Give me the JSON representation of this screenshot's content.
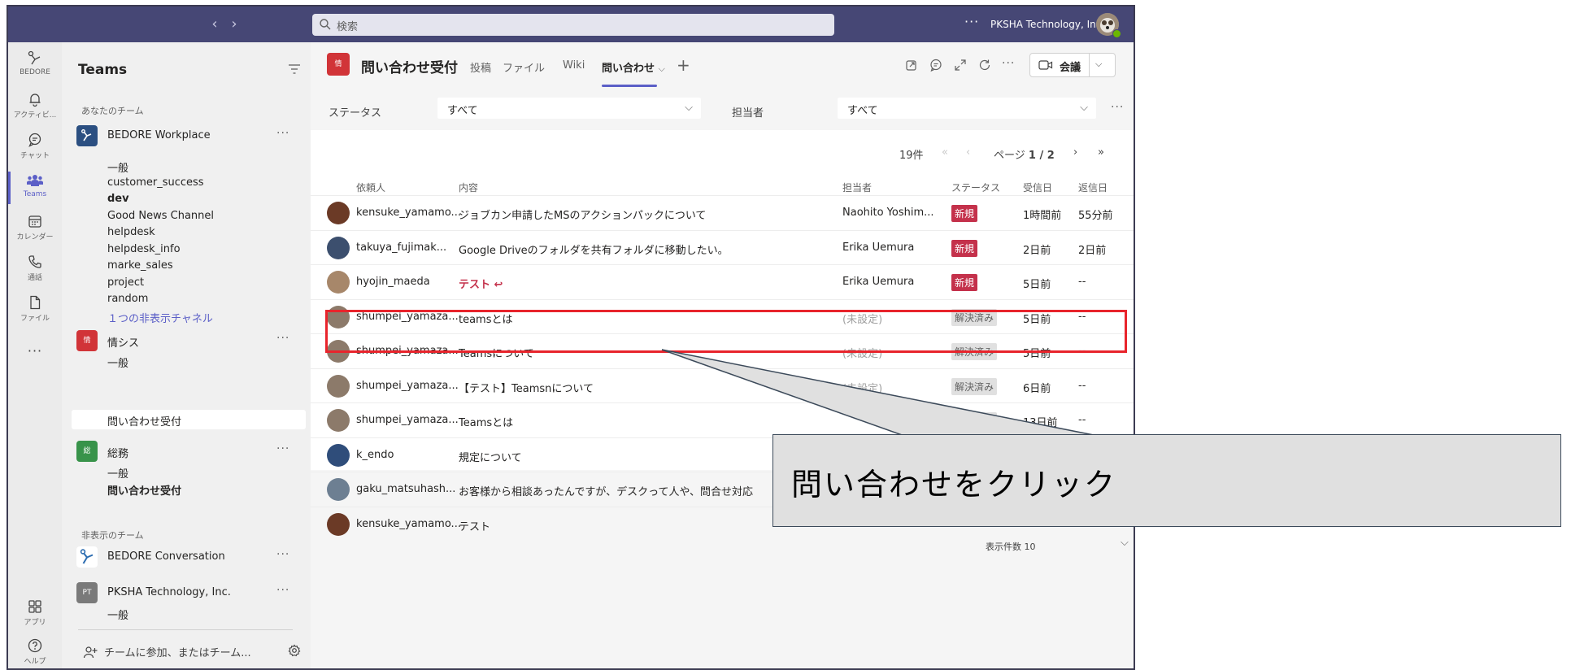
{
  "titlebar": {
    "search_placeholder": "検索",
    "more": "···",
    "org_name": "PKSHA Technology, Inc."
  },
  "rail": [
    {
      "label": "BEDORE",
      "icon": "bedore-logo-icon"
    },
    {
      "label": "アクティビ...",
      "icon": "bell-icon"
    },
    {
      "label": "チャット",
      "icon": "chat-icon"
    },
    {
      "label": "Teams",
      "icon": "teams-icon",
      "active": true
    },
    {
      "label": "カレンダー",
      "icon": "calendar-icon"
    },
    {
      "label": "通話",
      "icon": "phone-icon"
    },
    {
      "label": "ファイル",
      "icon": "file-icon"
    },
    {
      "label": "···",
      "icon": "more-icon"
    },
    {
      "label": "アプリ",
      "icon": "apps-icon"
    },
    {
      "label": "ヘルプ",
      "icon": "help-icon"
    }
  ],
  "sidebar": {
    "title": "Teams",
    "section_your_teams": "あなたのチーム",
    "section_hidden_teams": "非表示のチーム",
    "teams": [
      {
        "name": "BEDORE Workplace",
        "logo_text": "",
        "color": "#2b4f81"
      },
      {
        "name": "情シス",
        "logo_text": "情",
        "color": "#d13438"
      },
      {
        "name": "総務",
        "logo_text": "総",
        "color": "#38934a"
      },
      {
        "name": "BEDORE Conversation",
        "logo_text": "",
        "color": "#ffffff"
      },
      {
        "name": "PKSHA Technology, Inc.",
        "logo_text": "PT",
        "color": "#7a7a7a"
      }
    ],
    "team_more": "···",
    "channels_bedore": [
      "一般",
      "customer_success",
      "dev",
      "Good News Channel",
      "helpdesk",
      "helpdesk_info",
      "marke_sales",
      "project",
      "random",
      "１つの非表示チャネル"
    ],
    "channels_joshis": [
      "一般",
      "問い合わせ受付"
    ],
    "channels_somu": [
      "一般",
      "問い合わせ受付"
    ],
    "channels_pksha": [
      "一般"
    ],
    "join_label": "チームに参加、またはチーム..."
  },
  "header": {
    "channel_logo": "情",
    "channel_title": "問い合わせ受付",
    "tabs": [
      "投稿",
      "ファイル",
      "Wiki",
      "問い合わせ"
    ],
    "active_tab_chevron": "⌵",
    "add_tab": "+",
    "more": "···",
    "meet_label": "会議",
    "meet_chevron": "⌵"
  },
  "filters": {
    "status_label": "ステータス",
    "status_value": "すべて",
    "assignee_label": "担当者",
    "assignee_value": "すべて",
    "more": "···"
  },
  "pager": {
    "count": "19件",
    "page_prefix": "ページ",
    "page_value": "1 / 2"
  },
  "table": {
    "columns": [
      "依頼人",
      "内容",
      "担当者",
      "ステータス",
      "受信日",
      "返信日"
    ],
    "rows": [
      {
        "requester": "kensuke_yamamo...",
        "content": "ジョブカン申請したMSのアクションパックについて",
        "assignee": "Naohito Yoshim...",
        "status": "新規",
        "received": "1時間前",
        "replied": "55分前",
        "avatar": "#6b3a26"
      },
      {
        "requester": "takuya_fujimak...",
        "content": "Google Driveのフォルダを共有フォルダに移動したい。",
        "assignee": "Erika Uemura",
        "status": "新規",
        "received": "2日前",
        "replied": "2日前",
        "avatar": "#3c4f6e"
      },
      {
        "requester": "hyojin_maeda",
        "content": "テスト ↩",
        "assignee": "Erika Uemura",
        "status": "新規",
        "received": "5日前",
        "replied": "--",
        "avatar": "#a7876a"
      },
      {
        "requester": "shumpei_yamaza...",
        "content": "teamsとは",
        "assignee": "(未設定)",
        "status": "解決済み",
        "received": "5日前",
        "replied": "--",
        "avatar": "#8c7a6a"
      },
      {
        "requester": "shumpei_yamaza...",
        "content": "Teamsについて",
        "assignee": "(未設定)",
        "status": "解決済み",
        "received": "5日前",
        "replied": "--",
        "avatar": "#8c7a6a"
      },
      {
        "requester": "shumpei_yamaza...",
        "content": "【テスト】Teamsnについて",
        "assignee": "(未設定)",
        "status": "解決済み",
        "received": "6日前",
        "replied": "--",
        "avatar": "#8c7a6a"
      },
      {
        "requester": "shumpei_yamaza...",
        "content": "Teamsとは",
        "assignee": "",
        "status": "解決済み",
        "received": "13日前",
        "replied": "--",
        "avatar": "#8c7a6a"
      },
      {
        "requester": "k_endo",
        "content": "規定について",
        "assignee": "",
        "status": "",
        "received": "",
        "replied": "",
        "avatar": "#2f4d7a"
      },
      {
        "requester": "gaku_matsuhash...",
        "content": "お客様から相談あったんですが、デスクって人や、問合せ対応",
        "assignee": "",
        "status": "",
        "received": "",
        "replied": "",
        "avatar": "#6d7f92"
      },
      {
        "requester": "kensuke_yamamo...",
        "content": "テスト",
        "assignee": "",
        "status": "",
        "received": "",
        "replied": "",
        "avatar": "#6b3a26"
      }
    ],
    "per_page_label": "表示件数 10"
  },
  "annotation": {
    "callout_text": "問い合わせをクリック",
    "highlight_color": "#e8242c"
  }
}
